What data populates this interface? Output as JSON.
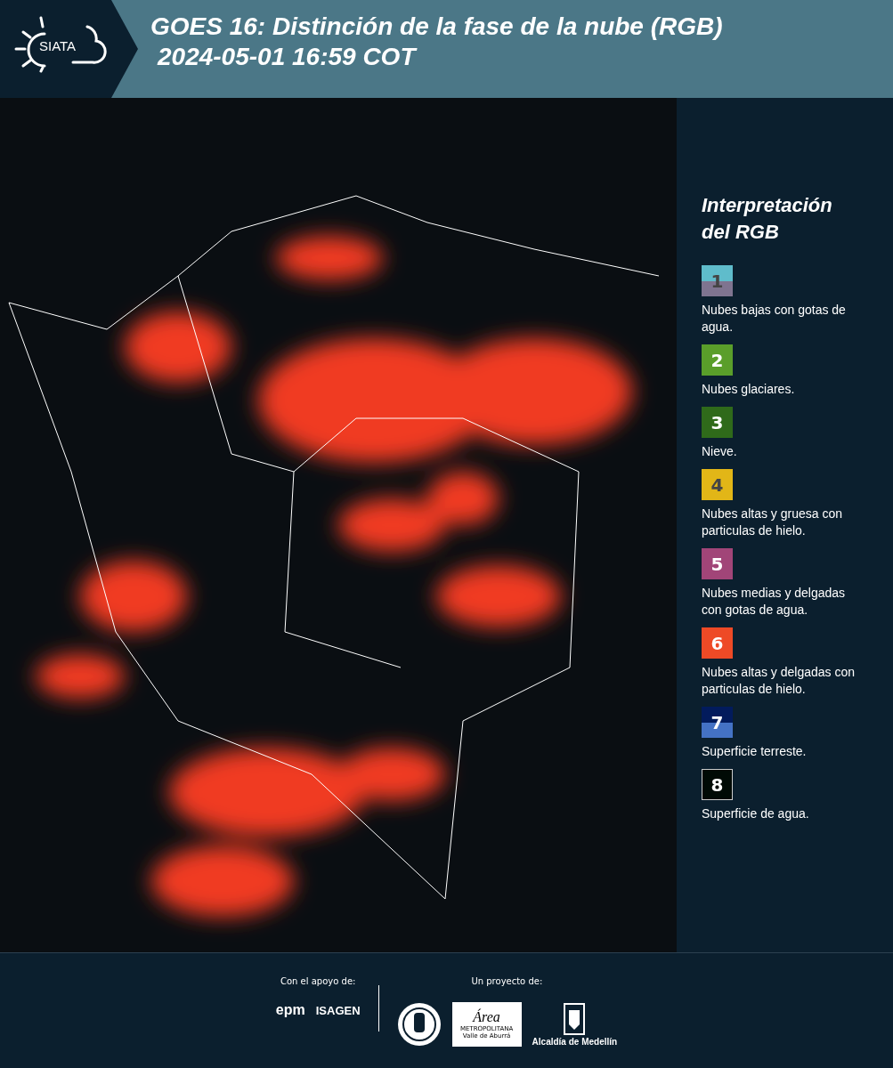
{
  "header": {
    "logo": "SIATA",
    "title_line_1": "GOES 16: Distinción de la fase de la nube (RGB)",
    "title_line_2": "2024-05-01 16:59 COT"
  },
  "legend": {
    "title_line_1": "Interpretación",
    "title_line_2": "del RGB",
    "items": [
      {
        "number": "1",
        "halves": [
          {
            "color": "#5fbccb"
          },
          {
            "color": "#7f7490"
          }
        ],
        "label": "Nubes bajas con gotas de agua."
      },
      {
        "number": "2",
        "color": "#5a9e2a",
        "label": "Nubes glaciares."
      },
      {
        "number": "3",
        "color": "#2f6a1a",
        "label": "Nieve."
      },
      {
        "number": "4",
        "color": "#e2b617",
        "label": "Nubes altas y gruesa con particulas de hielo."
      },
      {
        "number": "5",
        "color": "#a14578",
        "label": "Nubes medias y delgadas con gotas de agua."
      },
      {
        "number": "6",
        "color": "#ee4a26",
        "label": "Nubes altas y delgadas con particulas de hielo."
      },
      {
        "number": "7",
        "halves": [
          {
            "color": "#021b5c"
          },
          {
            "color": "#4472c4"
          }
        ],
        "label": "Superficie terreste."
      },
      {
        "number": "8",
        "color": "#000a05",
        "label": "Superficie de agua."
      }
    ]
  },
  "footer": {
    "support_label": "Con el apoyo de:",
    "support_logos": [
      "epm",
      "ISAGEN"
    ],
    "project_label": "Un proyecto de:",
    "area_logo": {
      "name": "Área",
      "line_1": "METROPOLITANA",
      "line_2": "Valle de Aburrá"
    },
    "city_logo": "Alcaldía de Medellín"
  }
}
